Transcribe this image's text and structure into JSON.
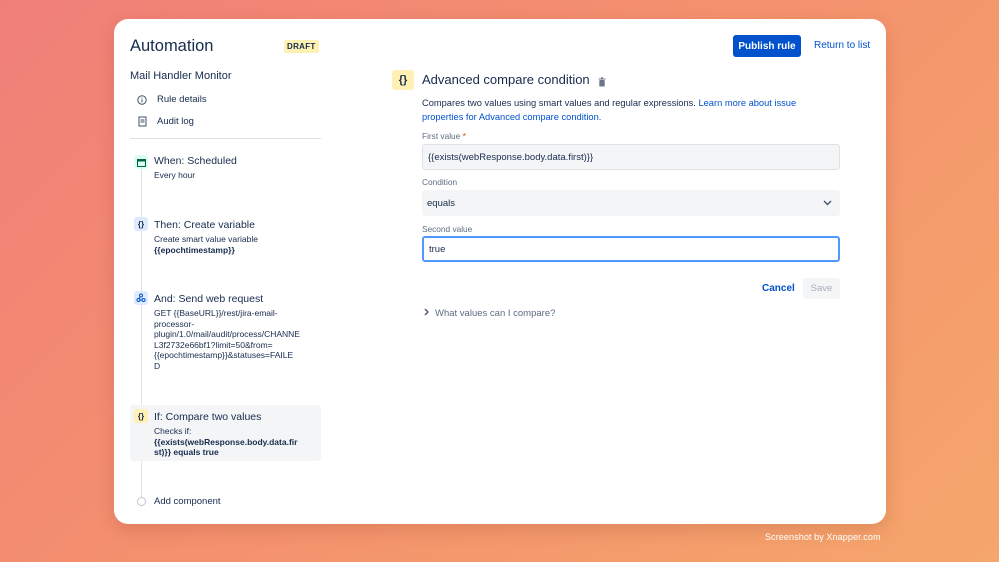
{
  "header": {
    "title": "Automation",
    "draft_badge": "DRAFT",
    "publish_label": "Publish rule",
    "return_label": "Return to list"
  },
  "sidebar": {
    "rule_name": "Mail Handler Monitor",
    "links": [
      {
        "label": "Rule details",
        "icon": "info-icon"
      },
      {
        "label": "Audit log",
        "icon": "document-icon"
      }
    ],
    "steps": [
      {
        "title": "When: Scheduled",
        "desc": "Every hour",
        "icon": "calendar-icon",
        "color": "#dcfff1"
      },
      {
        "title": "Then: Create variable",
        "desc": "Create smart value variable",
        "desc_bold": "{{epochtimestamp}}",
        "icon": "braces-icon",
        "color": "#deebff"
      },
      {
        "title": "And: Send web request",
        "desc_lines": [
          "GET {{BaseURL}}/rest/jira-email-",
          "processor-",
          "plugin/1.0/mail/audit/process/CHANNE",
          "L3f2732e66bf1?limit=50&from=",
          "{{epochtimestamp}}&statuses=FAILE",
          "D"
        ],
        "icon": "webhook-icon",
        "color": "#deebff"
      },
      {
        "title": "If: Compare two values",
        "desc": "Checks if:",
        "desc_bold_lines": [
          "{{exists(webResponse.body.data.fir",
          "st)}} equals true"
        ],
        "icon": "braces-icon",
        "color": "#fff0b3"
      }
    ],
    "add_component": "Add component"
  },
  "main": {
    "icon_glyph": "{}",
    "title": "Advanced compare condition",
    "desc_text": "Compares two values using smart values and regular expressions.",
    "desc_link_1": "Learn more about issue",
    "desc_link_2": "properties for Advanced compare condition.",
    "first_value_label": "First value",
    "required_mark": "*",
    "first_value": "{{exists(webResponse.body.data.first)}}",
    "condition_label": "Condition",
    "condition_value": "equals",
    "second_value_label": "Second value",
    "second_value": "true",
    "cancel_label": "Cancel",
    "save_label": "Save",
    "expander_label": "What values can I compare?"
  },
  "watermark": "Screenshot by Xnapper.com"
}
